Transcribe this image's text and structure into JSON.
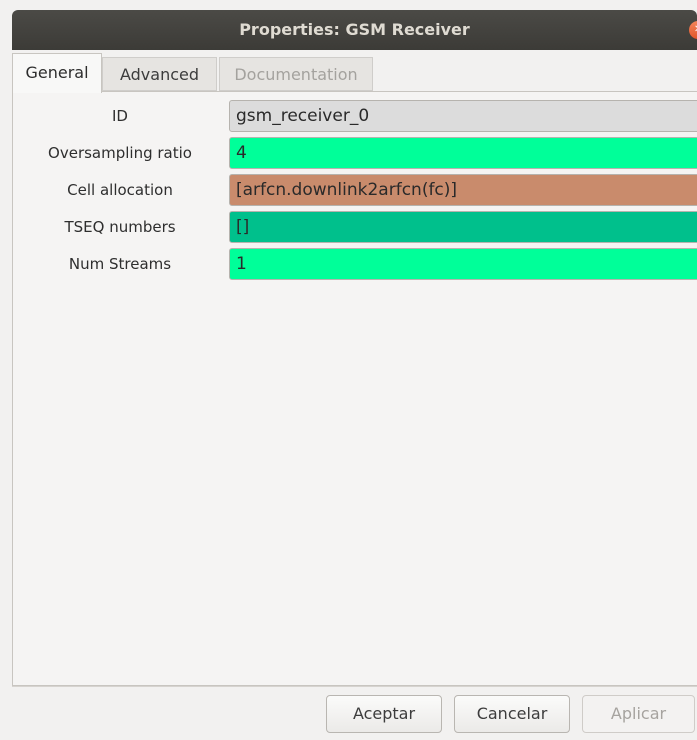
{
  "window": {
    "title": "Properties: GSM Receiver",
    "close_glyph": "✕"
  },
  "tabs": [
    {
      "label": "General",
      "state": "active"
    },
    {
      "label": "Advanced",
      "state": "inactive"
    },
    {
      "label": "Documentation",
      "state": "disabled"
    }
  ],
  "params": [
    {
      "label": "ID",
      "value": "gsm_receiver_0",
      "color": "#dcdcdc"
    },
    {
      "label": "Oversampling ratio",
      "value": "4",
      "color": "#00ff99"
    },
    {
      "label": "Cell allocation",
      "value": "[arfcn.downlink2arfcn(fc)]",
      "color": "#c98b6c"
    },
    {
      "label": "TSEQ numbers",
      "value": "[]",
      "color": "#00c08c"
    },
    {
      "label": "Num Streams",
      "value": "1",
      "color": "#00ff99"
    }
  ],
  "buttons": {
    "ok": "Aceptar",
    "cancel": "Cancelar",
    "apply": "Aplicar"
  }
}
